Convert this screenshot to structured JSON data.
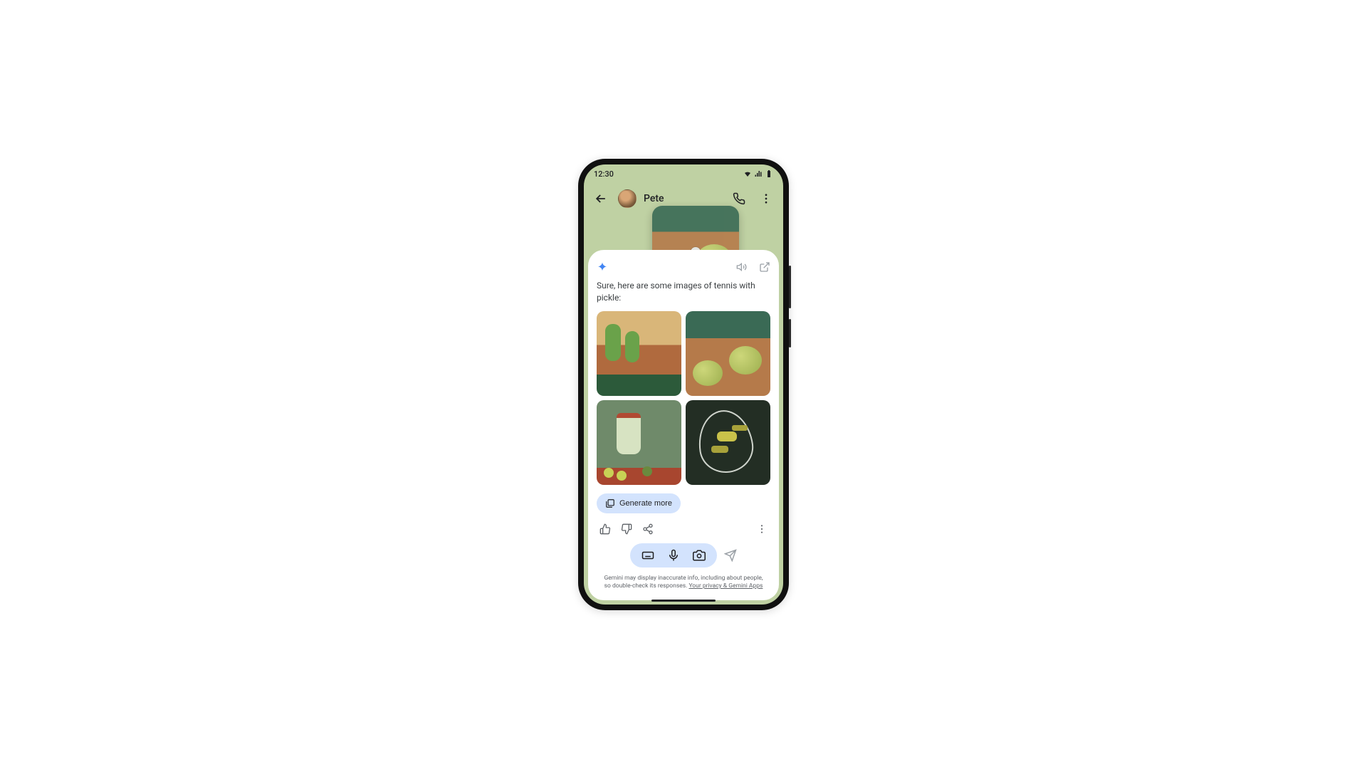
{
  "status": {
    "time": "12:30"
  },
  "chat": {
    "contact_name": "Pete"
  },
  "gemini": {
    "response_text": "Sure, here are some images of tennis with pickle:",
    "generate_more_label": "Generate more",
    "disclaimer_text": "Gemini may display inaccurate info, including about people, so double-check its responses.",
    "privacy_link_label": "Your privacy & Gemini Apps"
  },
  "images": {
    "names": [
      "tennis-pickle-1",
      "tennis-pickle-2",
      "tennis-pickle-3",
      "tennis-pickle-4"
    ]
  }
}
